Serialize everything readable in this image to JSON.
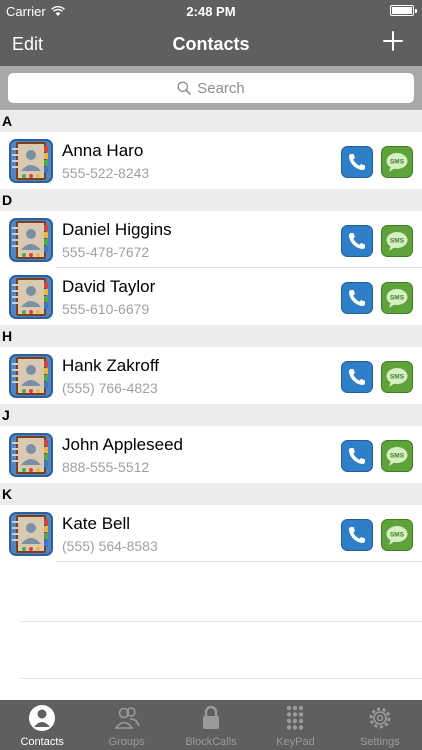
{
  "status": {
    "carrier": "Carrier",
    "time": "2:48 PM",
    "battery_level": 1.0
  },
  "nav": {
    "edit_label": "Edit",
    "title": "Contacts",
    "add_icon": "plus-icon"
  },
  "search": {
    "placeholder": "Search"
  },
  "sections": [
    {
      "letter": "A",
      "contacts": [
        {
          "name": "Anna Haro",
          "phone": "555-522-8243"
        }
      ]
    },
    {
      "letter": "D",
      "contacts": [
        {
          "name": "Daniel Higgins",
          "phone": "555-478-7672"
        },
        {
          "name": "David Taylor",
          "phone": "555-610-6679"
        }
      ]
    },
    {
      "letter": "H",
      "contacts": [
        {
          "name": "Hank Zakroff",
          "phone": "(555) 766-4823"
        }
      ]
    },
    {
      "letter": "J",
      "contacts": [
        {
          "name": "John Appleseed",
          "phone": "888-555-5512"
        }
      ]
    },
    {
      "letter": "K",
      "contacts": [
        {
          "name": "Kate Bell",
          "phone": "(555) 564-8583"
        }
      ]
    }
  ],
  "buttons": {
    "sms_label": "SMS"
  },
  "tabs": [
    {
      "label": "Contacts",
      "icon": "person-icon",
      "active": true
    },
    {
      "label": "Groups",
      "icon": "groups-icon",
      "active": false
    },
    {
      "label": "BlockCalls",
      "icon": "lock-icon",
      "active": false
    },
    {
      "label": "KeyPad",
      "icon": "keypad-icon",
      "active": false
    },
    {
      "label": "Settings",
      "icon": "gear-icon",
      "active": false
    }
  ],
  "colors": {
    "bar": "#5f5f5f",
    "call": "#2f7fc8",
    "sms": "#5ea33a",
    "section": "#ececec"
  }
}
